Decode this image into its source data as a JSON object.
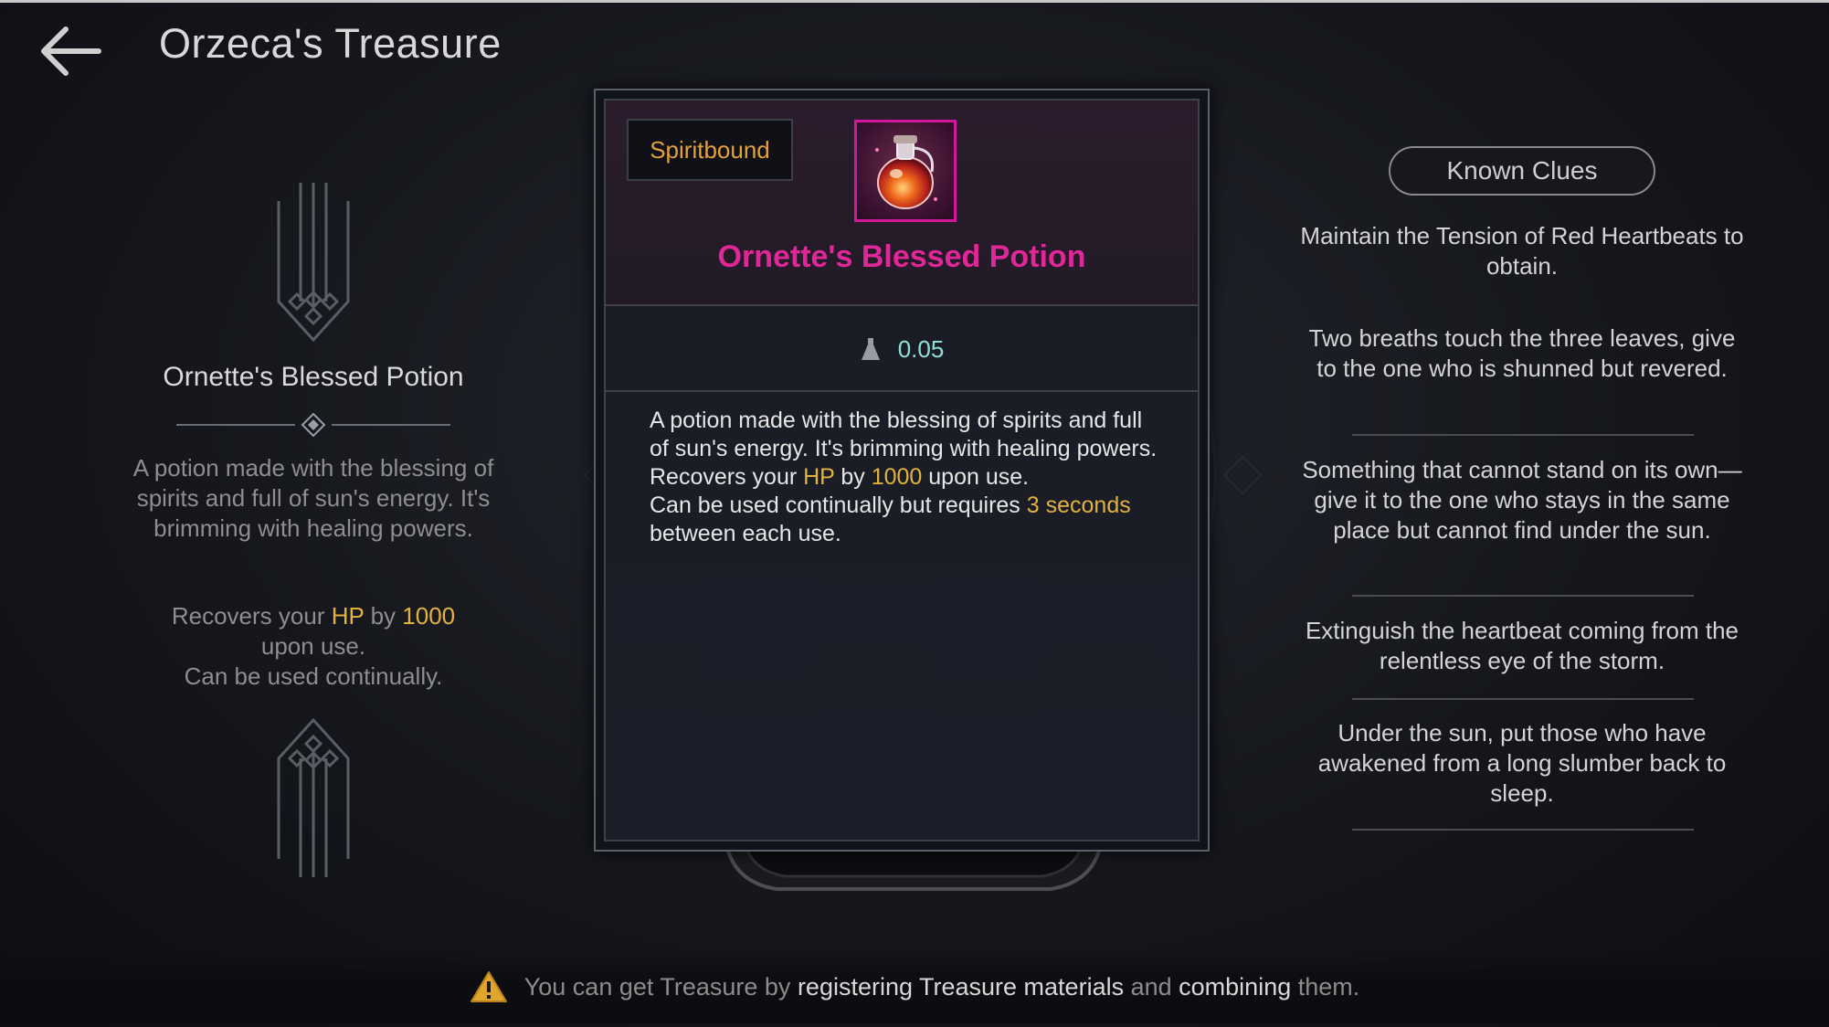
{
  "header": {
    "title": "Orzeca's Treasure"
  },
  "left_panel": {
    "item_name": "Ornette's Blessed Potion",
    "description": "A potion made with the blessing of spirits and full of sun's energy. It's brimming with healing powers.",
    "effect_prefix": "Recovers your ",
    "effect_stat": "HP",
    "effect_by": " by ",
    "effect_amount": "1000",
    "effect_suffix": " upon use.",
    "effect_note": "Can be used continually."
  },
  "card": {
    "bound_label": "Spiritbound",
    "item_name": "Ornette's Blessed Potion",
    "weight": "0.05",
    "description": "A potion made with the blessing of spirits and full of sun's energy. It's brimming with healing powers.",
    "effect_prefix": "Recovers your ",
    "effect_stat": "HP",
    "effect_by": " by ",
    "effect_amount": "1000",
    "effect_suffix": " upon use.",
    "cooldown_prefix": "Can be used continually but requires ",
    "cooldown_value": "3 seconds",
    "cooldown_suffix": " between each use.",
    "rarity_color": "#e12698"
  },
  "clues": {
    "button_label": "Known Clues",
    "items": [
      "Maintain the Tension of Red Heartbeats to obtain.",
      "Two breaths touch the three leaves, give to the one who is shunned but revered.",
      "Something that cannot stand on its own—give it to the one who stays in the same place but cannot find under the sun.",
      "Extinguish the heartbeat coming from the relentless eye of the storm.",
      "Under the sun, put those who have awakened from a long slumber back to sleep."
    ]
  },
  "footer": {
    "text_1": "You can get Treasure by ",
    "text_2": "registering Treasure materials",
    "text_3": " and ",
    "text_4": "combining",
    "text_5": " them."
  },
  "icons": {
    "back": "arrow-left-icon",
    "potion": "potion-icon",
    "weight": "weight-icon",
    "warning": "warning-icon"
  },
  "colors": {
    "highlight": "#e3b23c",
    "rarity": "#e12698",
    "bound": "#e6a03a",
    "weight": "#8fe0d4"
  }
}
